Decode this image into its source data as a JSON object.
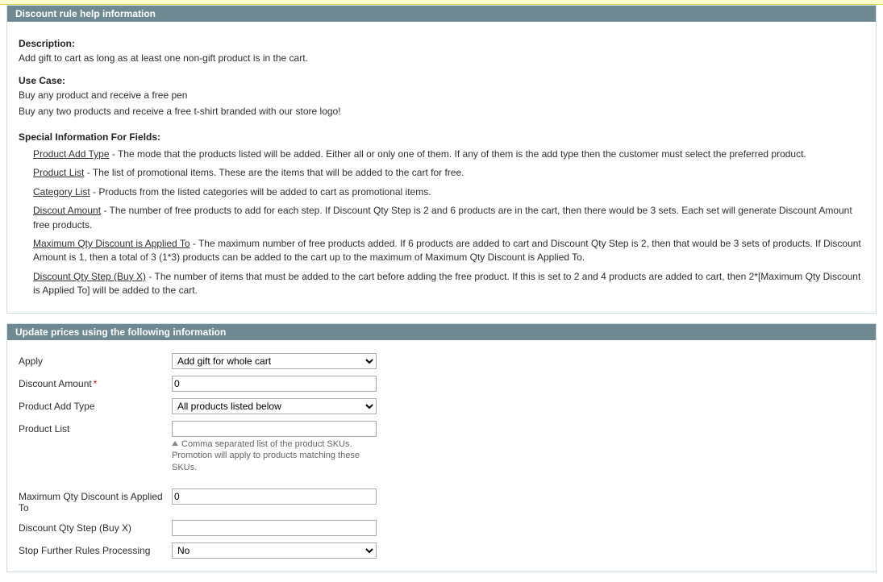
{
  "help_panel": {
    "title": "Discount rule help information",
    "description_label": "Description:",
    "description_text": "Add gift to cart as long as at least one non-gift product is in the cart.",
    "usecase_label": "Use Case:",
    "usecase_lines": [
      "Buy any product and receive a free pen",
      "Buy any two products and receive a free t-shirt branded with our store logo!"
    ],
    "special_label": "Special Information For Fields:",
    "defs": [
      {
        "term": "Product Add Type",
        "desc": " - The mode that the products listed will be added. Either all or only one of them. If any of them is the add type then the customer must select the preferred product."
      },
      {
        "term": "Product List",
        "desc": " - The list of promotional items. These are the items that will be added to the cart for free."
      },
      {
        "term": "Category List",
        "desc": " - Products from the listed categories will be added to cart as promotional items."
      },
      {
        "term": "Discout Amount",
        "desc": " - The number of free products to add for each step. If Discount Qty Step is 2 and 6 products are in the cart, then there would be 3 sets. Each set will generate Discount Amount free products."
      },
      {
        "term": "Maximum Qty Discount is Applied To",
        "desc": " - The maximum number of free products added. If 6 products are added to cart and Discount Qty Step is 2, then that would be 3 sets of products. If Discount Amount is 1, then a total of 3 (1*3) products can be added to the cart up to the maximum of Maximum Qty Discount is Applied To."
      },
      {
        "term": "Discount Qty Step (Buy X)",
        "desc": " - The number of items that must be added to the cart before adding the free product. If this is set to 2 and 4 products are added to cart, then 2*[Maximum Qty Discount is Applied To] will be added to the cart."
      }
    ]
  },
  "form_panel": {
    "title": "Update prices using the following information",
    "fields": {
      "apply": {
        "label": "Apply",
        "value": "Add gift for whole cart"
      },
      "discount_amount": {
        "label": "Discount Amount",
        "required": true,
        "value": "0"
      },
      "product_add_type": {
        "label": "Product Add Type",
        "value": "All products listed below"
      },
      "product_list": {
        "label": "Product List",
        "value": "",
        "hint": "Comma separated list of the product SKUs. Promotion will apply to products matching these SKUs."
      },
      "max_qty": {
        "label": "Maximum Qty Discount is Applied To",
        "value": "0"
      },
      "qty_step": {
        "label": "Discount Qty Step (Buy X)",
        "value": ""
      },
      "stop_rules": {
        "label": "Stop Further Rules Processing",
        "value": "No"
      }
    }
  }
}
